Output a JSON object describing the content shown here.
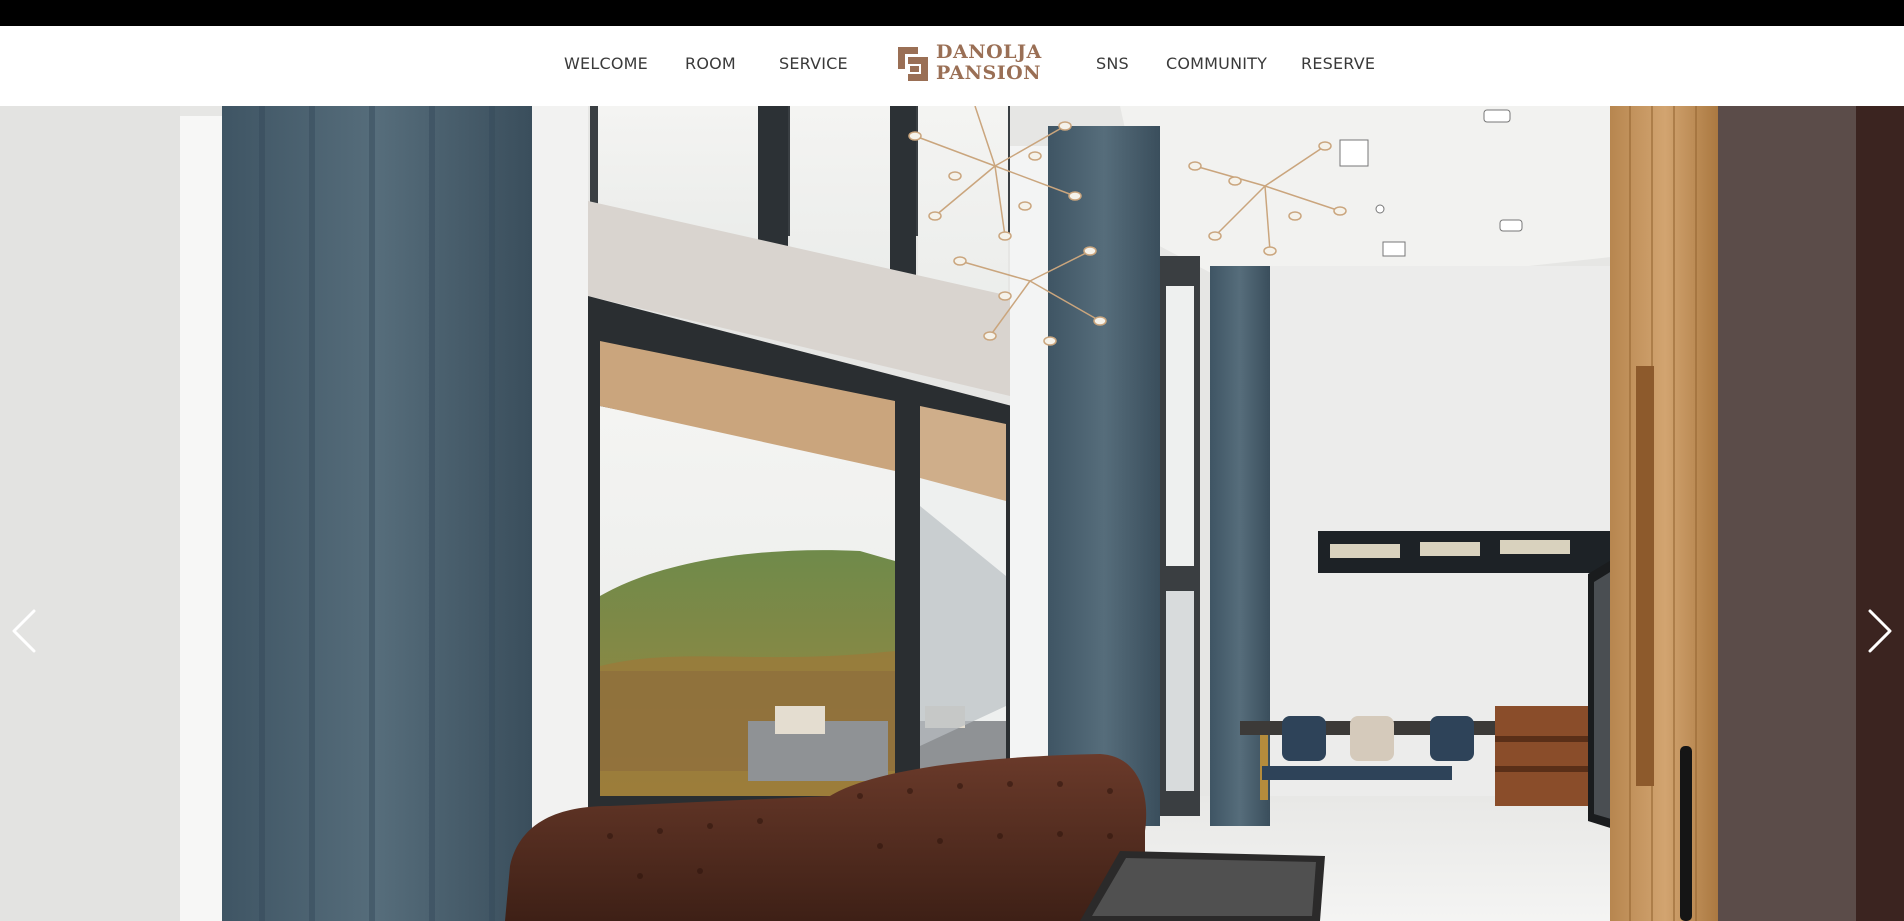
{
  "nav": {
    "items": [
      {
        "label": "WELCOME"
      },
      {
        "label": "ROOM"
      },
      {
        "label": "SERVICE"
      },
      {
        "label": "SNS"
      },
      {
        "label": "COMMUNITY"
      },
      {
        "label": "RESERVE"
      }
    ],
    "logo": {
      "line1": "DANOLJA",
      "line2": "PANSION"
    }
  },
  "slider": {
    "prev_icon": "chevron-left-icon",
    "next_icon": "chevron-right-icon"
  },
  "colors": {
    "brand": "#9a6f55",
    "nav_text": "#3a3a3a",
    "topbar": "#000000"
  }
}
